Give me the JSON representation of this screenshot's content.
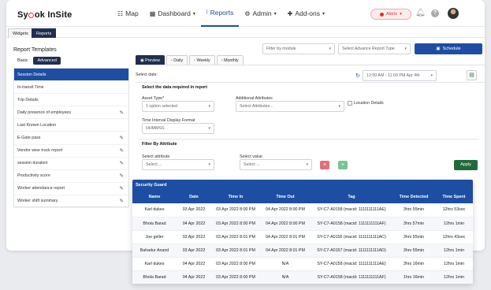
{
  "logo": {
    "pre": "Sy",
    "post": "ok InSite"
  },
  "nav": [
    {
      "icon": "☷",
      "icon_name": "map-icon",
      "label": "Map",
      "caret": false,
      "active": false
    },
    {
      "icon": "▦",
      "icon_name": "dashboard-icon",
      "label": "Dashboard",
      "caret": true,
      "active": false
    },
    {
      "icon": "⦚",
      "icon_name": "reports-icon",
      "label": "Reports",
      "caret": false,
      "active": true
    },
    {
      "icon": "⚙",
      "icon_name": "admin-gear-icon",
      "label": "Admin",
      "caret": true,
      "active": false
    },
    {
      "icon": "✚",
      "icon_name": "addons-icon",
      "label": "Add-ons",
      "caret": true,
      "active": false
    }
  ],
  "alerts": {
    "label": "Alerts",
    "caret": "▾"
  },
  "tabs": [
    "Widgets",
    "Reports"
  ],
  "panel": {
    "title": "Report Templates",
    "subtabs": [
      "Basic",
      "Advanced"
    ],
    "items": [
      "Session Details",
      "In-transit Time",
      "Trip Details",
      "Daily presence of employees",
      "Last Known Location",
      "E-Gate pass",
      "Vendor wise truck report",
      "session duration",
      "Productivity score",
      "Worker attendance report",
      "Worker shift summary"
    ]
  },
  "filters": {
    "module_placeholder": "Filter by module",
    "template_placeholder": "Select Advance Report Type",
    "schedule_label": "Schedule"
  },
  "preview_tabs": [
    "Preview",
    "Daily",
    "Weekly",
    "Monthly"
  ],
  "form": {
    "select_date": "Select date:",
    "date_range": "12:00 AM - 11:09 PM Apr 4th",
    "section_data": "Select the data required in report",
    "asset_type_label": "Asset Type*",
    "asset_type_value": "1 option selected",
    "additional_label": "Additional Attributes",
    "additional_placeholder": "Select Attributes...",
    "location_details": "Location Details",
    "time_format_label": "Time Interval Display Format",
    "time_format_value": "HHMMSS",
    "filter_section": "Filter By Attribute",
    "attr_label": "Select attribute",
    "attr_placeholder": "Select ...",
    "value_label": "Select value",
    "value_placeholder": "Select ...",
    "remove_symbol": "×",
    "add_symbol": "+",
    "apply_label": "Apply"
  },
  "table": {
    "caption": "Security Guard",
    "columns": [
      "Name",
      "Date",
      "Time In",
      "Time Out",
      "Tag",
      "Time Detected",
      "Time Spent"
    ],
    "rows": [
      [
        "Karl dukes",
        "03 Apr 2022",
        "03 Apr 2022 8:00 PM",
        "04 Apr 2022 8:00 PM",
        "SY-C7-A0158 (macid: 1111111111AE)",
        "3hrs 55min",
        "12hrs 53sec"
      ],
      [
        "Bhola Barad",
        "04 Apr 2022",
        "03 Apr 2022 8:00 PM",
        "04 Apr 2022 8:00 PM",
        "SY-C7-A0158 (macid: 1111111111AF)",
        "3hrs 57min",
        "12hrs 1min"
      ],
      [
        "Joe geller",
        "03 Apr 2022",
        "03 Apr 2022 8:01 PM",
        "04 Apr 2022 8:01 PM",
        "SY-C7-A0156 (macid: 1111111111AC)",
        "3hrs 55min",
        "12hrs 43sec"
      ],
      [
        "Bahadur Anand",
        "03 Apr 2022",
        "03 Apr 2022 8:01 PM",
        "04 Apr 2022 8:01 PM",
        "SY-C7-A0157 (macid: 1111111111AD)",
        "3hrs 55min",
        "12hrs 1min"
      ],
      [
        "Karl dukes",
        "04 Apr 2022",
        "03 Apr 2022 8:00 PM",
        "N/A",
        "SY-C7-A0158 (macid: 1111111111AE)",
        "3hrs 16min",
        "12hrs 1min"
      ],
      [
        "Bhola Barad",
        "04 Apr 2022",
        "03 Apr 2022 8:00 PM",
        "N/A",
        "SY-C7-A0158 (macid: 1111111111AF)",
        "1hrs 16min",
        "12hrs 1min"
      ]
    ]
  },
  "colors": {
    "accent": "#1d4ea3",
    "dark": "#1f2f4f",
    "apply": "#1e6a3a",
    "remove": "#e36f7a",
    "add": "#79c493"
  }
}
